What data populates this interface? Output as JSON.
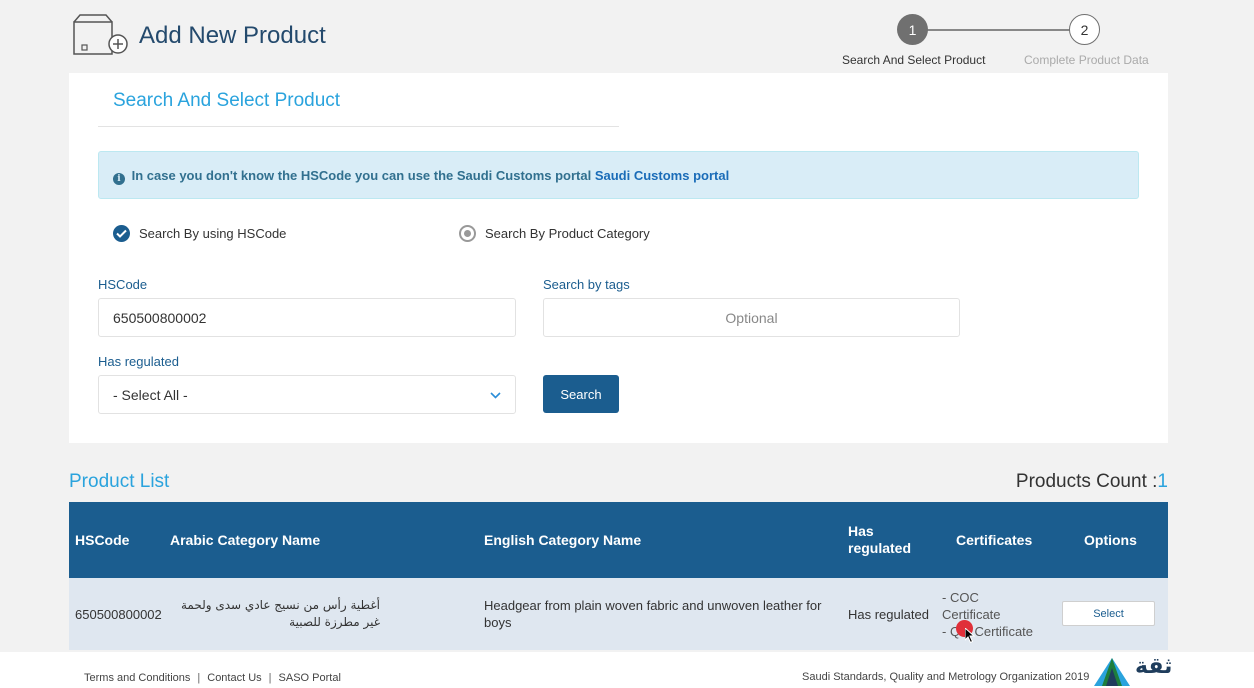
{
  "header": {
    "title": "Add New Product",
    "steps": [
      {
        "number": "1",
        "label": "Search And Select Product"
      },
      {
        "number": "2",
        "label": "Complete Product Data"
      }
    ]
  },
  "search_panel": {
    "title": "Search And Select Product",
    "alert_text": "In case you don't know the HSCode you can use the Saudi Customs portal ",
    "alert_link": "Saudi Customs portal",
    "radio_hscode": "Search By using HSCode",
    "radio_category": "Search By Product Category",
    "hscode_label": "HSCode",
    "hscode_value": "650500800002",
    "tags_label": "Search by tags",
    "tags_placeholder": "Optional",
    "regulated_label": "Has regulated",
    "regulated_value": "- Select All -",
    "search_button": "Search"
  },
  "product_list": {
    "title": "Product List",
    "count_label": "Products Count :",
    "count_value": "1",
    "columns": [
      "HSCode",
      "Arabic Category Name",
      "English Category Name",
      "Has regulated",
      "Certificates",
      "Options"
    ],
    "rows": [
      {
        "hscode": "650500800002",
        "arabic": "أغطية رأس من نسيج عادي سدى ولحمة غير مطرزة للصبية",
        "english": "Headgear from plain woven fabric and unwoven leather for boys",
        "regulated": "Has regulated",
        "cert1": "- COC",
        "cert2": "Certificate",
        "cert3": "- QM Certificate",
        "option": "Select"
      }
    ]
  },
  "footer": {
    "terms": "Terms and Conditions",
    "contact": "Contact Us",
    "portal": "SASO Portal",
    "org": "Saudi Standards, Quality and Metrology Organization 2019",
    "logo_text": "ثقة"
  },
  "colors": {
    "accent": "#2aa3dd",
    "primary": "#1b5d8f",
    "alert_bg": "#d9edf7",
    "row_bg": "#dfe7f0"
  }
}
